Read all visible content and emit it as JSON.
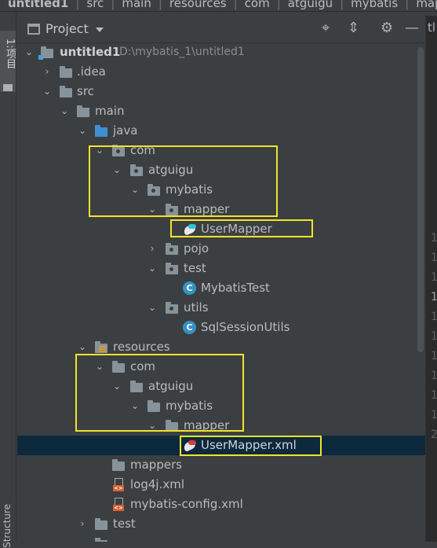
{
  "breadcrumb": [
    "untitled1",
    "src",
    "main",
    "resources",
    "com",
    "atguigu",
    "mybatis",
    "mapper"
  ],
  "left_strip": {
    "project_tab": "1:项目",
    "structure_tab": "Structure"
  },
  "panel": {
    "title": "Project"
  },
  "right_strip": {
    "tab": "tl",
    "line_numbers": [
      "1",
      "1",
      "1",
      "1",
      "1",
      "1",
      "1",
      "1",
      "1",
      "1",
      "2"
    ]
  },
  "tree": [
    {
      "label": "untitled1",
      "hint": "D:\\mybatis_1\\untitled1",
      "icon": "module-folder-icon",
      "arrow": "expanded"
    },
    {
      "label": ".idea",
      "icon": "folder-icon",
      "arrow": "collapsed"
    },
    {
      "label": "src",
      "icon": "folder-icon",
      "arrow": "expanded"
    },
    {
      "label": "main",
      "icon": "folder-icon",
      "arrow": "expanded"
    },
    {
      "label": "java",
      "icon": "source-folder-icon",
      "arrow": "expanded"
    },
    {
      "label": "com",
      "icon": "package-icon",
      "arrow": "expanded"
    },
    {
      "label": "atguigu",
      "icon": "package-icon",
      "arrow": "expanded"
    },
    {
      "label": "mybatis",
      "icon": "package-icon",
      "arrow": "expanded"
    },
    {
      "label": "mapper",
      "icon": "package-icon",
      "arrow": "expanded"
    },
    {
      "label": "UserMapper",
      "icon": "mybatis-mapper-icon",
      "arrow": "none"
    },
    {
      "label": "pojo",
      "icon": "package-icon",
      "arrow": "collapsed"
    },
    {
      "label": "test",
      "icon": "package-icon",
      "arrow": "expanded"
    },
    {
      "label": "MybatisTest",
      "icon": "java-class-icon",
      "arrow": "none"
    },
    {
      "label": "utils",
      "icon": "package-icon",
      "arrow": "expanded"
    },
    {
      "label": "SqlSessionUtils",
      "icon": "java-class-icon",
      "arrow": "none"
    },
    {
      "label": "resources",
      "icon": "resources-folder-icon",
      "arrow": "expanded"
    },
    {
      "label": "com",
      "icon": "folder-icon",
      "arrow": "expanded"
    },
    {
      "label": "atguigu",
      "icon": "folder-icon",
      "arrow": "expanded"
    },
    {
      "label": "mybatis",
      "icon": "folder-icon",
      "arrow": "expanded"
    },
    {
      "label": "mapper",
      "icon": "folder-icon",
      "arrow": "expanded"
    },
    {
      "label": "UserMapper.xml",
      "icon": "mybatis-xml-icon",
      "arrow": "none",
      "selected": true
    },
    {
      "label": "mappers",
      "icon": "folder-icon",
      "arrow": "none"
    },
    {
      "label": "log4j.xml",
      "icon": "xml-file-icon",
      "arrow": "none"
    },
    {
      "label": "mybatis-config.xml",
      "icon": "xml-file-icon",
      "arrow": "none"
    },
    {
      "label": "test",
      "icon": "folder-icon",
      "arrow": "collapsed"
    }
  ],
  "colors": {
    "background": "#3c3f41",
    "selection": "#0d293e",
    "highlight_box": "#f2e22c",
    "java_class": "#3592c4",
    "xml": "#d35f32"
  }
}
